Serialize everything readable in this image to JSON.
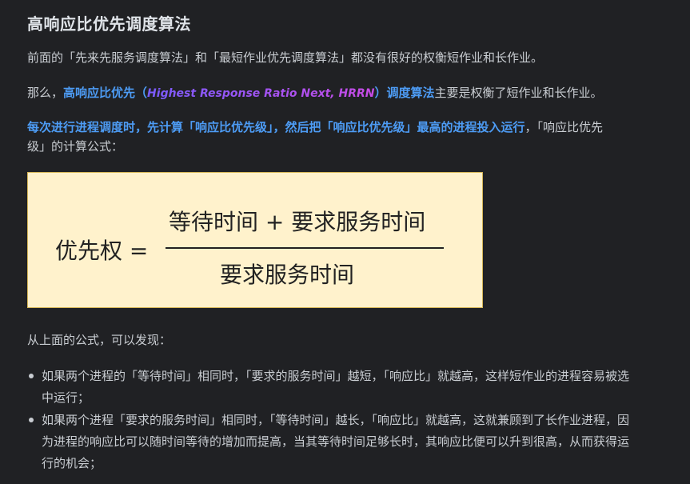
{
  "title": "高响应比优先调度算法",
  "para1": "前面的「先来先服务调度算法」和「最短作业优先调度算法」都没有很好的权衡短作业和长作业。",
  "para2": {
    "prefix": "那么，",
    "algo_name": "高响应比优先",
    "open_paren": "（",
    "english_name": "Highest Response Ratio Next, HRRN",
    "close_paren": "）",
    "algo_suffix": "调度算法",
    "rest": "主要是权衡了短作业和长作业。"
  },
  "para3": {
    "bold": "每次进行进程调度时，先计算「响应比优先级」，然后把「响应比优先级」最高的进程投入运行",
    "rest": "，「响应比优先级」的计算公式："
  },
  "formula": {
    "left": "优先权 =",
    "numerator": "等待时间 + 要求服务时间",
    "denominator": "要求服务时间"
  },
  "para4": "从上面的公式，可以发现：",
  "bullets": [
    "如果两个进程的「等待时间」相同时，「要求的服务时间」越短，「响应比」就越高，这样短作业的进程容易被选中运行；",
    "如果两个进程「要求的服务时间」相同时，「等待时间」越长，「响应比」就越高，这就兼顾到了长作业进程，因为进程的响应比可以随时间等待的增加而提高，当其等待时间足够长时，其响应比便可以升到很高，从而获得运行的机会；"
  ]
}
